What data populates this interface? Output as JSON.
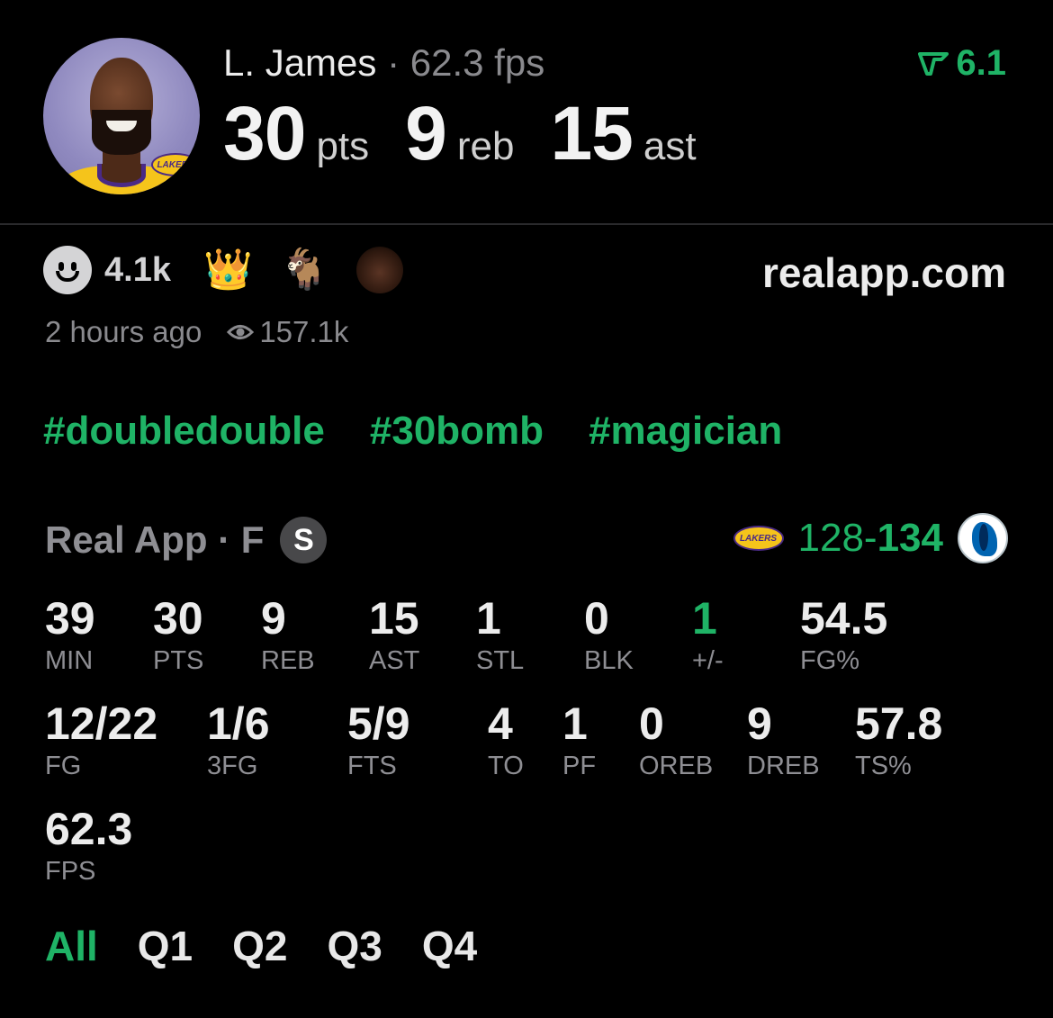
{
  "player": {
    "name": "L. James",
    "separator": "·",
    "fps_text": "62.3 fps",
    "pts": "30",
    "pts_unit": "pts",
    "reb": "9",
    "reb_unit": "reb",
    "ast": "15",
    "ast_unit": "ast",
    "team_logo_text": "LAKERS"
  },
  "rating": {
    "value": "6.1",
    "color": "#1fb366"
  },
  "reactions": {
    "count": "4.1k",
    "emojis": [
      "crown-emoji",
      "goat-emoji",
      "face-emoji"
    ],
    "crown": "👑",
    "goat": "🐐"
  },
  "site": "realapp.com",
  "meta": {
    "time": "2 hours ago",
    "views": "157.1k"
  },
  "hashtags": [
    "#doubledouble",
    "#30bomb",
    "#magician"
  ],
  "game": {
    "source": "Real App · F",
    "badge": "S",
    "home_logo_text": "LAKERS",
    "score_left": "128",
    "score_sep": "-",
    "score_right": "134"
  },
  "stats": [
    {
      "value": "39",
      "label": "MIN"
    },
    {
      "value": "30",
      "label": "PTS"
    },
    {
      "value": "9",
      "label": "REB"
    },
    {
      "value": "15",
      "label": "AST"
    },
    {
      "value": "1",
      "label": "STL"
    },
    {
      "value": "0",
      "label": "BLK"
    },
    {
      "value": "1",
      "label": "+/-"
    },
    {
      "value": "54.5",
      "label": "FG%"
    },
    {
      "value": "12/22",
      "label": "FG"
    },
    {
      "value": "1/6",
      "label": "3FG"
    },
    {
      "value": "5/9",
      "label": "FTS"
    },
    {
      "value": "4",
      "label": "TO"
    },
    {
      "value": "1",
      "label": "PF"
    },
    {
      "value": "0",
      "label": "OREB"
    },
    {
      "value": "9",
      "label": "DREB"
    },
    {
      "value": "57.8",
      "label": "TS%"
    },
    {
      "value": "62.3",
      "label": "FPS"
    }
  ],
  "tabs": [
    "All",
    "Q1",
    "Q2",
    "Q3",
    "Q4"
  ],
  "active_tab": "All",
  "colors": {
    "accent": "#1fb366",
    "background": "#000000",
    "muted": "#8e8e93"
  }
}
